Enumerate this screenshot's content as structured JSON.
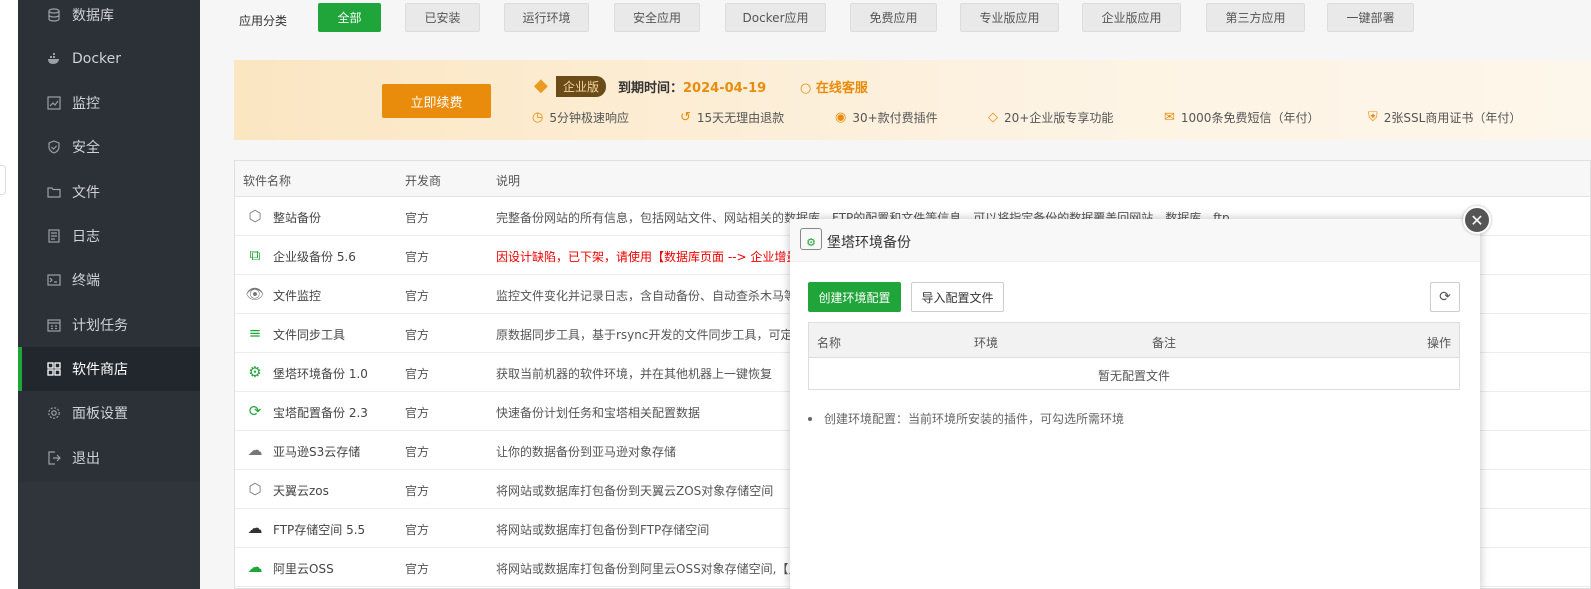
{
  "sidebar": {
    "items": [
      {
        "label": "数据库",
        "icon": "database-icon"
      },
      {
        "label": "Docker",
        "icon": "docker-icon"
      },
      {
        "label": "监控",
        "icon": "monitor-icon"
      },
      {
        "label": "安全",
        "icon": "shield-icon"
      },
      {
        "label": "文件",
        "icon": "folder-icon"
      },
      {
        "label": "日志",
        "icon": "log-icon"
      },
      {
        "label": "终端",
        "icon": "terminal-icon"
      },
      {
        "label": "计划任务",
        "icon": "calendar-icon"
      },
      {
        "label": "软件商店",
        "icon": "grid-icon",
        "active": true
      },
      {
        "label": "面板设置",
        "icon": "gear-icon"
      },
      {
        "label": "退出",
        "icon": "logout-icon"
      }
    ]
  },
  "categories": {
    "label": "应用分类",
    "items": [
      "全部",
      "已安装",
      "运行环境",
      "安全应用",
      "Docker应用",
      "免费应用",
      "专业版应用",
      "企业版应用",
      "第三方应用",
      "一键部署"
    ]
  },
  "banner": {
    "renew": "立即续费",
    "edition": "企业版",
    "expire_label": "到期时间：",
    "expire_date": "2024-04-19",
    "support": "在线客服",
    "features": [
      "5分钟极速响应",
      "15天无理由退款",
      "30+款付费插件",
      "20+企业版专享功能",
      "1000条免费短信（年付）",
      "2张SSL商用证书（年付）"
    ]
  },
  "table": {
    "headers": [
      "软件名称",
      "开发商",
      "说明"
    ],
    "rows": [
      {
        "name": "整站备份",
        "dev": "官方",
        "desc": "完整备份网站的所有信息，包括网站文件、网站相关的数据库、FTP的配置和文件等信息，可以将指定备份的数据覆盖回网站、数据库、ftp。"
      },
      {
        "name": "企业级备份 5.6",
        "dev": "官方",
        "desc": "因设计缺陷，已下架，请使用【数据库页面 --> 企业增量"
      },
      {
        "name": "文件监控",
        "dev": "官方",
        "desc": "监控文件变化并记录日志，含自动备份、自动查杀木马等"
      },
      {
        "name": "文件同步工具",
        "dev": "官方",
        "desc": "原数据同步工具，基于rsync开发的文件同步工具，可定时"
      },
      {
        "name": "堡塔环境备份 1.0",
        "dev": "官方",
        "desc": "获取当前机器的软件环境，并在其他机器上一键恢复"
      },
      {
        "name": "宝塔配置备份 2.3",
        "dev": "官方",
        "desc": "快速备份计划任务和宝塔相关配置数据"
      },
      {
        "name": "亚马逊S3云存储",
        "dev": "官方",
        "desc": "让你的数据备份到亚马逊对象存储"
      },
      {
        "name": "天翼云zos",
        "dev": "官方",
        "desc": "将网站或数据库打包备份到天翼云ZOS对象存储空间"
      },
      {
        "name": "FTP存储空间 5.5",
        "dev": "官方",
        "desc": "将网站或数据库打包备份到FTP存储空间"
      },
      {
        "name": "阿里云OSS",
        "dev": "官方",
        "desc": "将网站或数据库打包备份到阿里云OSS对象存储空间,【点"
      }
    ]
  },
  "modal": {
    "title": "堡塔环境备份",
    "create_btn": "创建环境配置",
    "import_btn": "导入配置文件",
    "headers": [
      "名称",
      "环境",
      "备注",
      "操作"
    ],
    "empty": "暂无配置文件",
    "note": "创建环境配置：当前环境所安装的插件，可勾选所需环境"
  }
}
